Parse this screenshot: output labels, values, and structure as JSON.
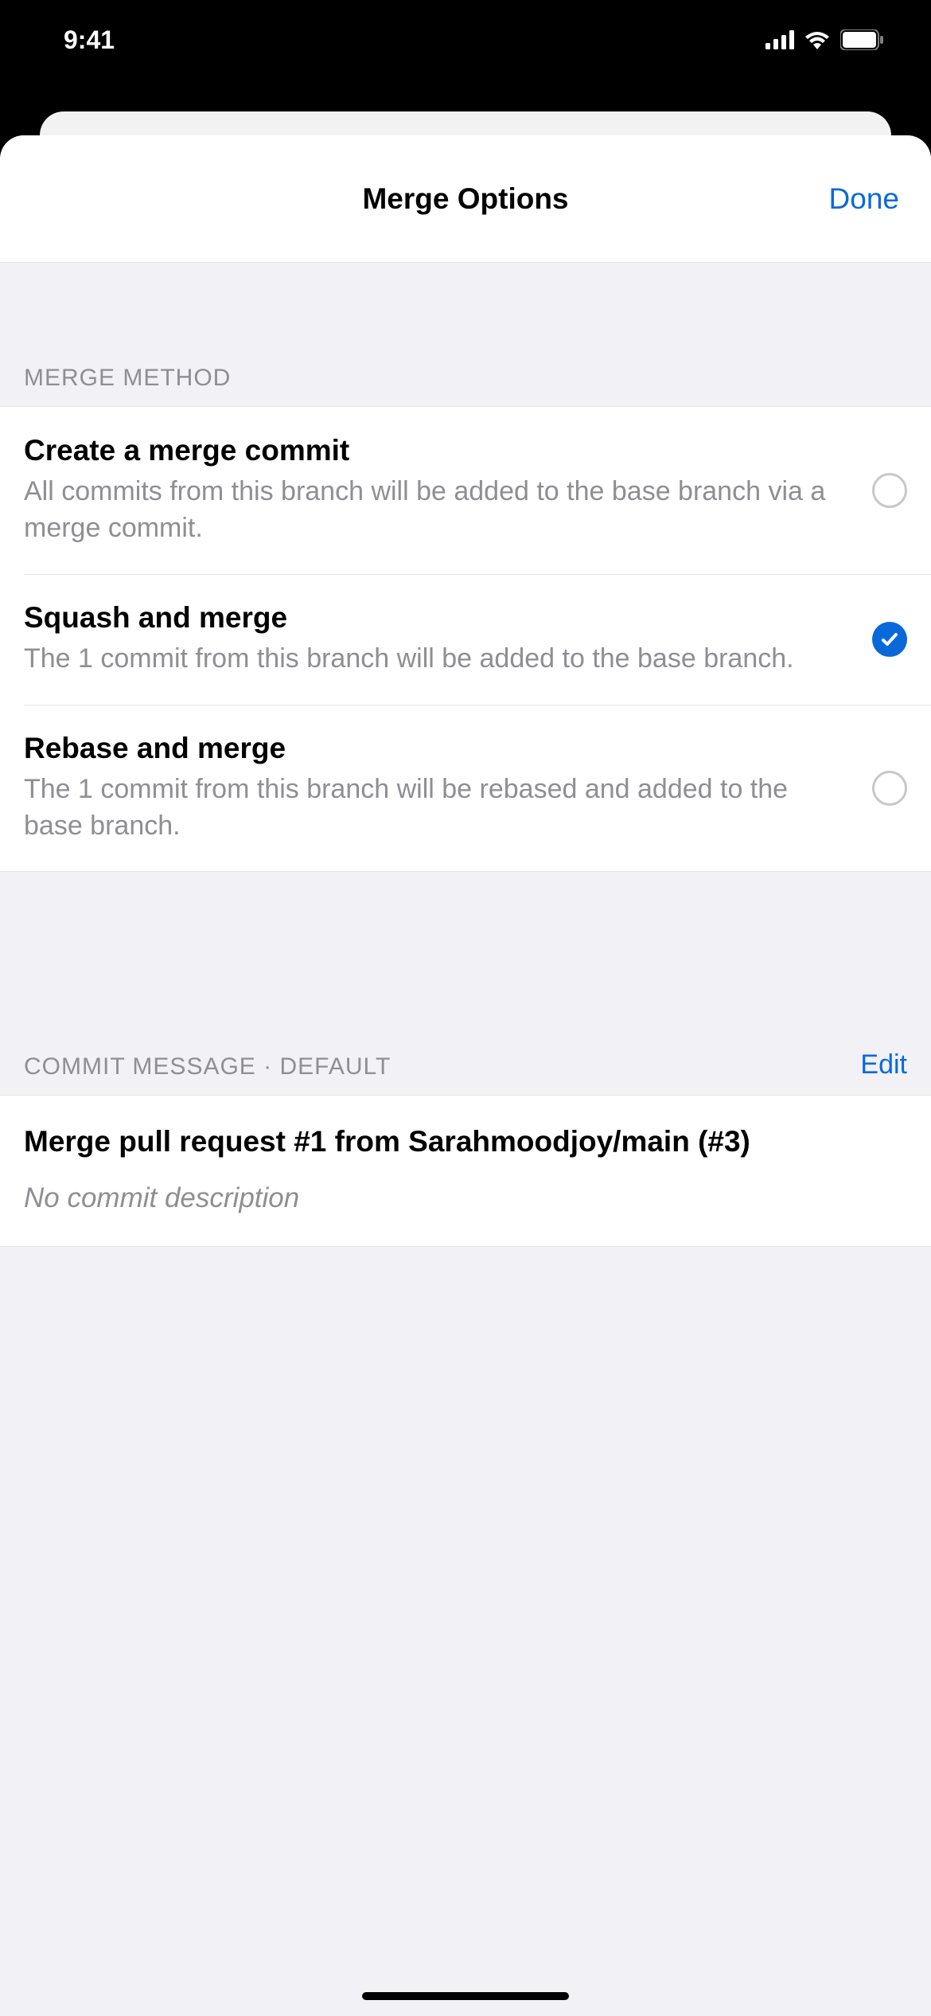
{
  "statusBar": {
    "time": "9:41"
  },
  "nav": {
    "title": "Merge Options",
    "done": "Done"
  },
  "sections": {
    "mergeMethod": {
      "header": "MERGE METHOD",
      "options": [
        {
          "title": "Create a merge commit",
          "desc": "All commits from this branch will be added to the base branch via a merge commit.",
          "selected": false
        },
        {
          "title": "Squash and merge",
          "desc": "The 1 commit from this branch will be added to the base branch.",
          "selected": true
        },
        {
          "title": "Rebase and merge",
          "desc": "The 1 commit from this branch will be rebased and added to the base branch.",
          "selected": false
        }
      ]
    },
    "commitMessage": {
      "header": "COMMIT MESSAGE · DEFAULT",
      "editLabel": "Edit",
      "title": "Merge pull request #1 from Sarahmoodjoy/main (#3)",
      "description": "No commit description"
    }
  }
}
